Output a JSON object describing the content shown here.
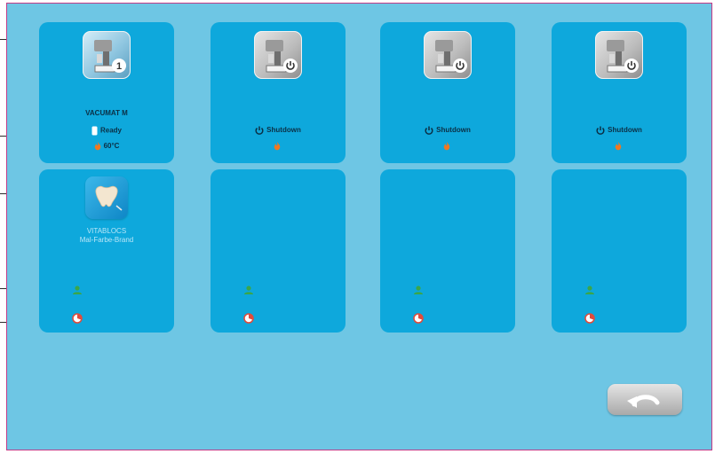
{
  "devices": [
    {
      "name": "VACUMAT M",
      "badge": "1",
      "status": "Ready",
      "temperature": "60°C",
      "status_icon": "rect-status-icon",
      "flame_icon": "flame-icon"
    },
    {
      "name": "",
      "badge": "power",
      "status": "Shutdown",
      "temperature": "",
      "status_icon": "power-icon",
      "flame_icon": "flame-icon"
    },
    {
      "name": "",
      "badge": "power",
      "status": "Shutdown",
      "temperature": "",
      "status_icon": "power-icon",
      "flame_icon": "flame-icon"
    },
    {
      "name": "",
      "badge": "power",
      "status": "Shutdown",
      "temperature": "",
      "status_icon": "power-icon",
      "flame_icon": "flame-icon"
    }
  ],
  "programs": [
    {
      "line1": "VITABLOCS",
      "line2": "Mal-Farbe-Brand",
      "icon": "tooth-icon"
    },
    {
      "line1": "",
      "line2": ""
    },
    {
      "line1": "",
      "line2": ""
    },
    {
      "line1": "",
      "line2": ""
    }
  ],
  "colors": {
    "screen_bg": "#6ec6e4",
    "card_bg": "#0ea8dc",
    "frame": "#c23a86",
    "flame": "#f07820",
    "user": "#3aa64a",
    "clock": "#e04a3a"
  },
  "back_button": {
    "icon": "back-arrow-icon"
  }
}
